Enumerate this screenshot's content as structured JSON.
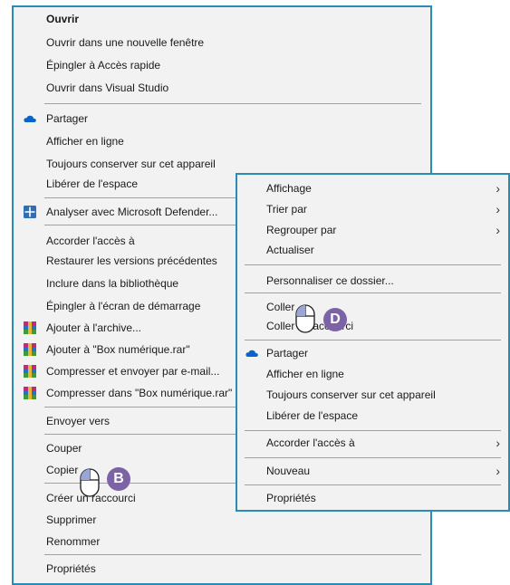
{
  "left_menu": {
    "items": [
      {
        "label": "Ouvrir"
      },
      {
        "label": "Ouvrir dans une nouvelle fenêtre"
      },
      {
        "label": "Épingler à Accès rapide"
      },
      {
        "label": "Ouvrir dans Visual Studio"
      },
      {
        "label": "Partager",
        "icon": "onedrive-cloud-icon"
      },
      {
        "label": "Afficher en ligne"
      },
      {
        "label": "Toujours conserver sur cet appareil"
      },
      {
        "label": "Libérer de l'espace"
      },
      {
        "label": "Analyser avec Microsoft Defender...",
        "icon": "defender-shield-icon"
      },
      {
        "label": "Accorder l'accès à"
      },
      {
        "label": "Restaurer les versions précédentes"
      },
      {
        "label": "Inclure dans la bibliothèque"
      },
      {
        "label": "Épingler à l'écran de démarrage"
      },
      {
        "label": "Ajouter à l'archive...",
        "icon": "winrar-icon"
      },
      {
        "label": "Ajouter à \"Box numérique.rar\"",
        "icon": "winrar-icon"
      },
      {
        "label": "Compresser et envoyer par e-mail...",
        "icon": "winrar-icon"
      },
      {
        "label": "Compresser dans \"Box numérique.rar\" et envoyer par e-mail",
        "icon": "winrar-icon"
      },
      {
        "label": "Envoyer vers"
      },
      {
        "label": "Couper"
      },
      {
        "label": "Copier"
      },
      {
        "label": "Créer un raccourci"
      },
      {
        "label": "Supprimer"
      },
      {
        "label": "Renommer"
      },
      {
        "label": "Propriétés"
      }
    ]
  },
  "right_menu": {
    "items": [
      {
        "label": "Affichage",
        "submenu": true
      },
      {
        "label": "Trier par",
        "submenu": true
      },
      {
        "label": "Regrouper par",
        "submenu": true
      },
      {
        "label": "Actualiser"
      },
      {
        "label": "Personnaliser ce dossier..."
      },
      {
        "label": "Coller"
      },
      {
        "label": "Coller le raccourci"
      },
      {
        "label": "Partager",
        "icon": "onedrive-cloud-icon"
      },
      {
        "label": "Afficher en ligne"
      },
      {
        "label": "Toujours conserver sur cet appareil"
      },
      {
        "label": "Libérer de l'espace"
      },
      {
        "label": "Accorder l'accès à",
        "submenu": true
      },
      {
        "label": "Nouveau",
        "submenu": true
      },
      {
        "label": "Propriétés"
      }
    ],
    "chevron": "›"
  },
  "badges": {
    "b": "B",
    "d": "D"
  },
  "colors": {
    "border": "#2a8bb5",
    "menu_bg": "#f2f2f2",
    "badge": "#7b63a5",
    "onedrive": "#0a64c8"
  }
}
